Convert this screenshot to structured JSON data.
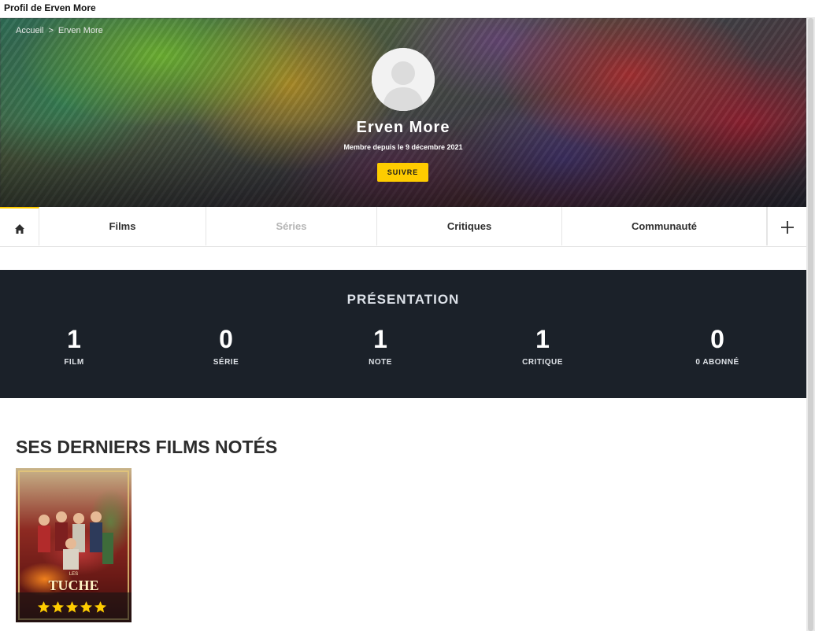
{
  "window": {
    "title": "Profil de Erven More"
  },
  "breadcrumb": {
    "home": "Accueil",
    "separator": ">",
    "current": "Erven More"
  },
  "profile": {
    "name": "Erven More",
    "member_since": "Membre depuis le 9 décembre 2021",
    "follow_label": "SUIVRE"
  },
  "tabs": {
    "home_icon": "home-icon",
    "films": "Films",
    "series": "Séries",
    "critiques": "Critiques",
    "communaute": "Communauté",
    "more_icon": "plus-icon"
  },
  "presentation": {
    "title": "PRÉSENTATION",
    "stats": [
      {
        "value": "1",
        "label": "FILM"
      },
      {
        "value": "0",
        "label": "SÉRIE"
      },
      {
        "value": "1",
        "label": "NOTE"
      },
      {
        "value": "1",
        "label": "CRITIQUE"
      },
      {
        "value": "0",
        "label": "0 ABONNÉ"
      }
    ]
  },
  "last_films": {
    "title": "SES DERNIERS FILMS NOTÉS",
    "items": [
      {
        "poster_title": "TUCHE",
        "poster_prefix": "LES",
        "rating_stars": 5,
        "rating_max": 5
      }
    ]
  },
  "colors": {
    "accent": "#fecc00",
    "presentation_bg": "#1b2129",
    "tab_disabled": "#b5b5b5"
  }
}
